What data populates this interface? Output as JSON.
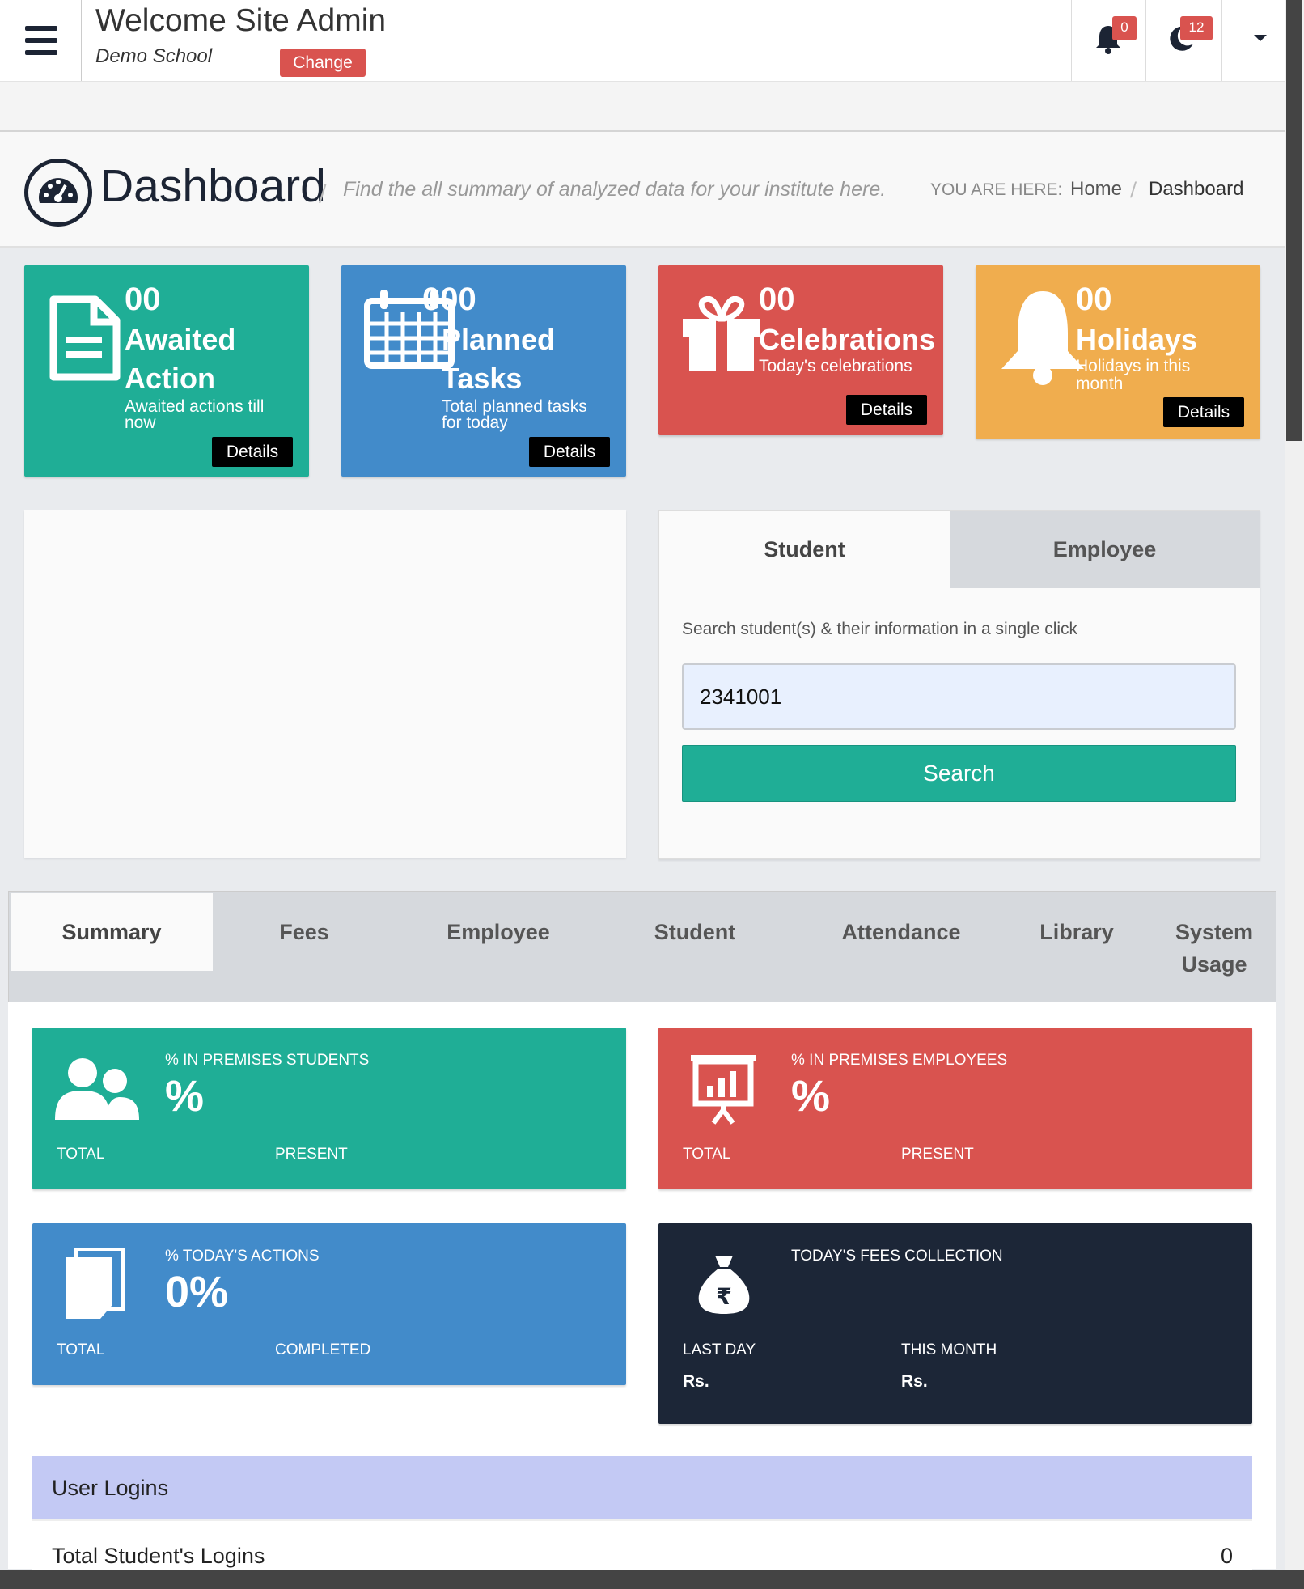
{
  "header": {
    "welcome": "Welcome Site Admin",
    "school": "Demo School",
    "change_label": "Change",
    "notifications_count": "0",
    "messages_count": "12"
  },
  "page": {
    "title": "Dashboard",
    "subtitle": "Find the all summary of analyzed data for your institute here.",
    "breadcrumb_label": "YOU ARE HERE:",
    "breadcrumb": [
      "Home",
      "Dashboard"
    ]
  },
  "cards": [
    {
      "count": "00",
      "title1": "Awaited",
      "title2": "Action",
      "sub1": "Awaited actions till",
      "sub2": "now",
      "details": "Details",
      "color": "#1fae96",
      "icon": "document-icon"
    },
    {
      "count": "000",
      "title1": "Planned",
      "title2": "Tasks",
      "sub1": "Total planned tasks",
      "sub2": "for today",
      "details": "Details",
      "color": "#428bca",
      "icon": "calendar-icon"
    },
    {
      "count": "00",
      "title1": "Celebrations",
      "title2": "",
      "sub1": "Today's celebrations",
      "sub2": "",
      "details": "Details",
      "color": "#d9534f",
      "icon": "gift-icon"
    },
    {
      "count": "00",
      "title1": "Holidays",
      "title2": "",
      "sub1": "Holidays in this",
      "sub2": "month",
      "details": "Details",
      "color": "#f0ad4e",
      "icon": "bell-icon"
    }
  ],
  "search": {
    "tabs": [
      "Student",
      "Employee"
    ],
    "hint": "Search student(s) & their information in a single click",
    "value": "2341001",
    "button": "Search"
  },
  "summary_tabs": [
    "Summary",
    "Fees",
    "Employee",
    "Student",
    "Attendance",
    "Library",
    "System",
    "Usage"
  ],
  "tiles": {
    "students": {
      "heading": "% IN PREMISES STUDENTS",
      "value": "%",
      "left": "TOTAL",
      "right": "PRESENT",
      "color": "#1fae96"
    },
    "employees": {
      "heading": "% IN PREMISES EMPLOYEES",
      "value": "%",
      "left": "TOTAL",
      "right": "PRESENT",
      "color": "#d9534f"
    },
    "actions": {
      "heading": "% TODAY'S ACTIONS",
      "value": "0%",
      "left": "TOTAL",
      "right": "COMPLETED",
      "color": "#428bca"
    },
    "fees": {
      "heading": "TODAY'S FEES COLLECTION",
      "left": "LAST DAY",
      "right": "THIS MONTH",
      "left_val": "Rs.",
      "right_val": "Rs.",
      "color": "#1c2637"
    }
  },
  "logins": {
    "heading": "User Logins",
    "row_label": "Total Student's Logins",
    "row_value": "0"
  }
}
